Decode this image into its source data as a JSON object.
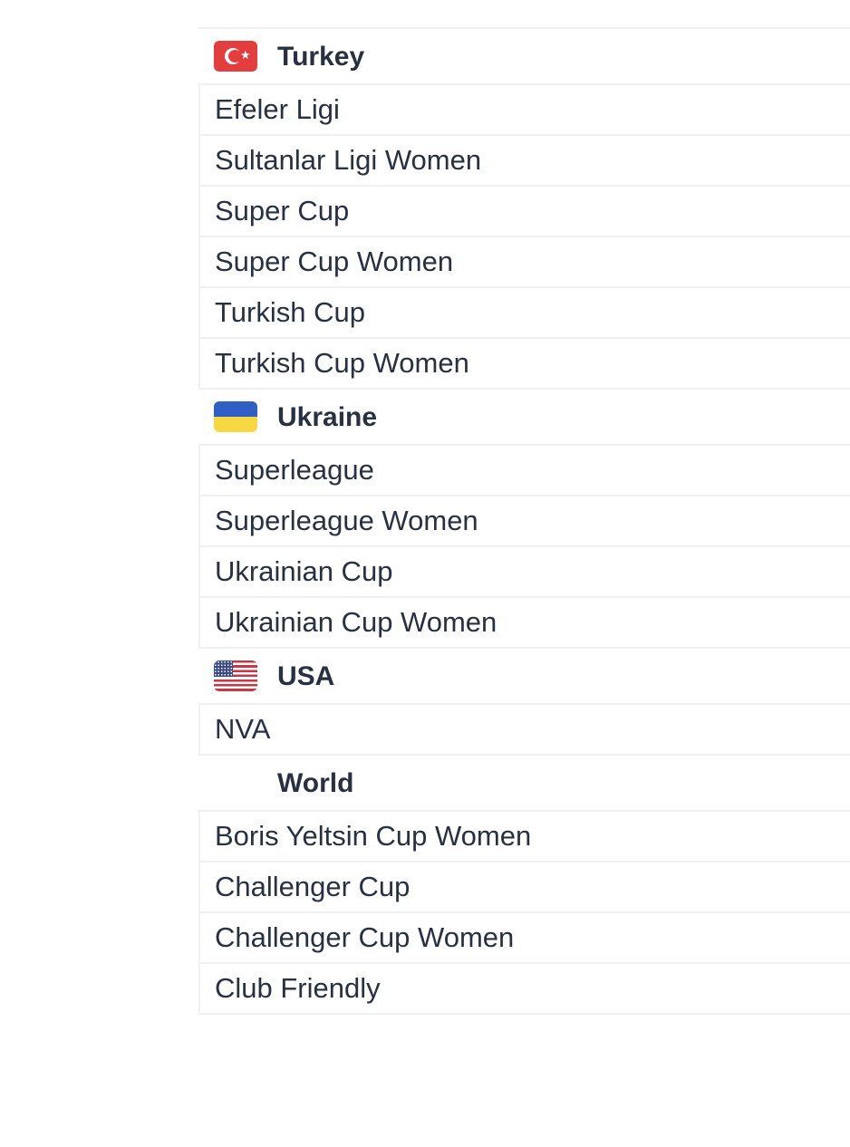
{
  "groups": [
    {
      "country": "Turkey",
      "flag_icon": "turkey-flag-icon",
      "leagues": [
        "Efeler Ligi",
        "Sultanlar Ligi Women",
        "Super Cup",
        "Super Cup Women",
        "Turkish Cup",
        "Turkish Cup Women"
      ]
    },
    {
      "country": "Ukraine",
      "flag_icon": "ukraine-flag-icon",
      "leagues": [
        "Superleague",
        "Superleague Women",
        "Ukrainian Cup",
        "Ukrainian Cup Women"
      ]
    },
    {
      "country": "USA",
      "flag_icon": "usa-flag-icon",
      "leagues": [
        "NVA"
      ]
    },
    {
      "country": "World",
      "flag_icon": "",
      "leagues": [
        "Boris Yeltsin Cup Women",
        "Challenger Cup",
        "Challenger Cup Women",
        "Club Friendly"
      ]
    }
  ],
  "colors": {
    "text": "#273142",
    "divider": "#eef0f2",
    "turkey_red": "#e43d3d",
    "ukraine_blue": "#2f5fc3",
    "ukraine_yellow": "#f7d843",
    "usa_red": "#c73745",
    "usa_blue": "#3b4a8a"
  }
}
